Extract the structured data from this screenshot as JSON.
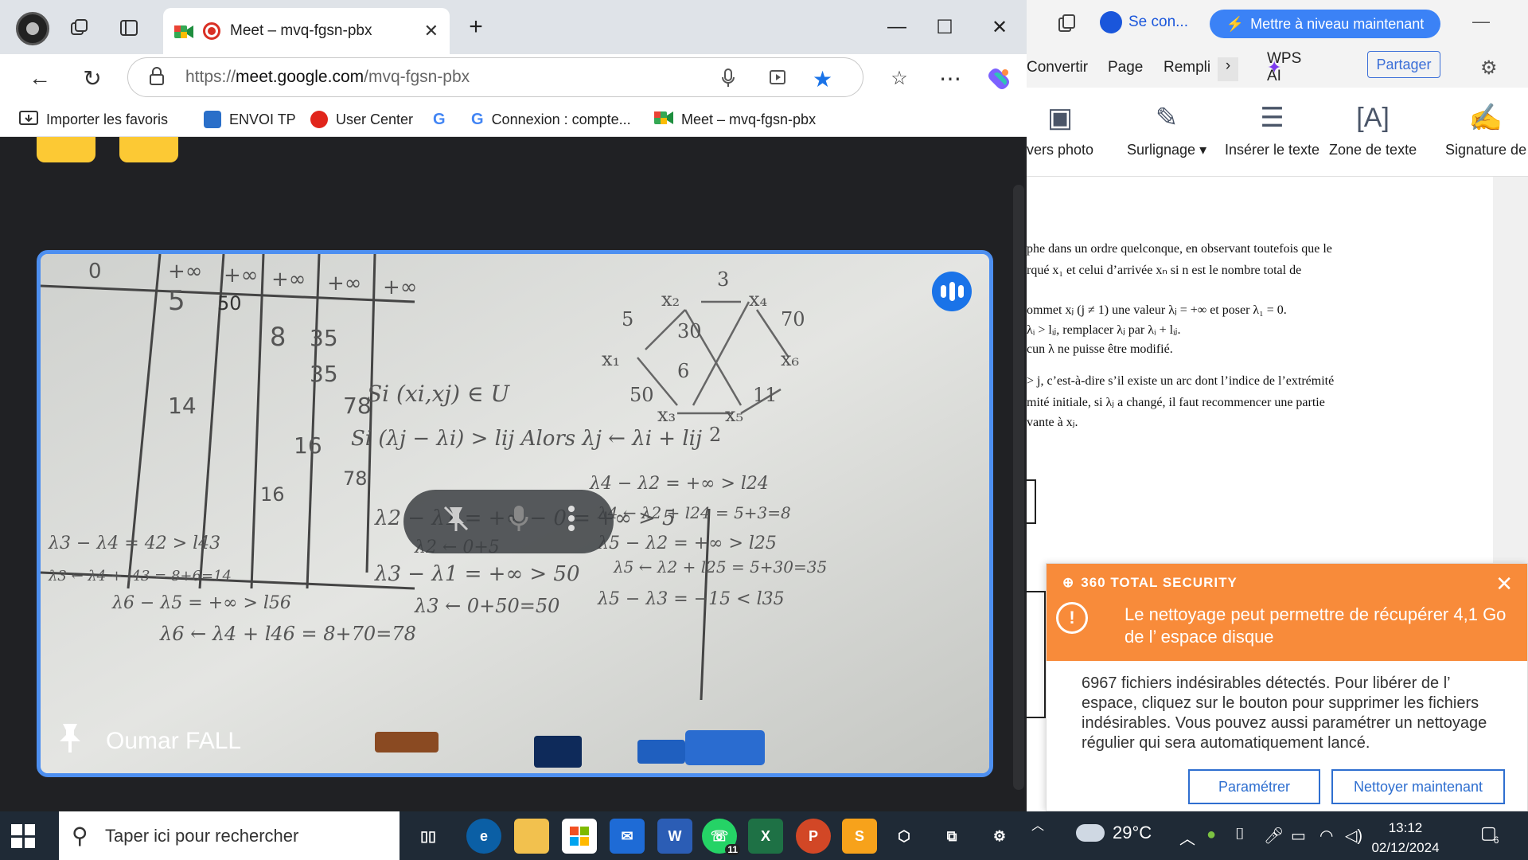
{
  "browser": {
    "tab": {
      "title": "Meet – mvq-fgsn-pbx"
    },
    "window_controls": {
      "minimize": "—",
      "maximize": "☐",
      "close": "✕"
    },
    "url": {
      "scheme": "https://",
      "host": "meet.google.com",
      "path": "/mvq-fgsn-pbx"
    },
    "bookmarks": [
      {
        "label": "Importer les favoris"
      },
      {
        "label": "ENVOI TP"
      },
      {
        "label": "User Center"
      },
      {
        "label": "Connexion : compte..."
      },
      {
        "label": "Meet – mvq-fgsn-pbx"
      }
    ]
  },
  "meet": {
    "participant_name": "Oumar FALL",
    "board_text": [
      "Si (xi,xj) ∈ U",
      "Si (λj − λi) > lij   Alors λj ← λi + lij",
      "λ2 − λ1 = +∞ − 0 = +∞ > 5",
      "λ2 ← 0+5",
      "λ3 − λ1 = +∞ > 50",
      "λ3 ← 0+50=50",
      "λ4 − λ2 = +∞ > l24",
      "λ4 ← λ2 + l24 = 5+3=8",
      "λ5 − λ2 = +∞ > l25",
      "λ5 ← λ2 + l25 = 5+30=35",
      "λ5 − λ3 = −15 < l35",
      "λ3 − λ4 = 42 > l43",
      "λ3 ← λ4 + l43 = 8+6=14",
      "λ6 − λ5 = +∞ > l56",
      "λ6 ← λ4 + l46 = 8+70=78"
    ],
    "table_cols": [
      "0",
      "+∞",
      "+∞",
      "+∞",
      "+∞",
      "+∞"
    ],
    "table_cells": [
      "5",
      "50",
      "8",
      "35",
      "35",
      "78",
      "14",
      "16",
      "16",
      "78"
    ]
  },
  "wps": {
    "signin": "Se con...",
    "upgrade": "Mettre à niveau maintenant",
    "menu": [
      "Convertir",
      "Page",
      "Rempli"
    ],
    "wps_ai": "WPS AI",
    "share": "Partager",
    "ribbon": [
      {
        "label": "vers photo"
      },
      {
        "label": "Surlignage"
      },
      {
        "label": "Insérer le texte"
      },
      {
        "label": "Zone de texte"
      },
      {
        "label": "Signature de"
      }
    ],
    "doc_lines": [
      "phe dans un ordre quelconque, en observant toutefois que le",
      "rqué x₁ et celui d’arrivée xₙ si n est le nombre total de",
      "",
      "ommet xⱼ (j ≠ 1) une valeur λⱼ = +∞ et poser λ₁ = 0.",
      "λᵢ > lᵢⱼ, remplacer λⱼ par λᵢ + lᵢⱼ.",
      "cun λ ne puisse être modifié.",
      "",
      "> j, c’est-à-dire s’il existe un arc dont l’indice de l’extrémité",
      "mité initiale, si λⱼ a changé, il faut recommencer une partie",
      "vante à xⱼ."
    ]
  },
  "popup": {
    "brand": "360 TOTAL SECURITY",
    "title": "Le nettoyage peut permettre de récupérer 4,1 Go de l’ espace disque",
    "body": "6967 fichiers indésirables détectés. Pour libérer de l’ espace, cliquez sur le bouton pour supprimer les fichiers indésirables. Vous pouvez aussi paramétrer un nettoyage régulier qui sera automatiquement lancé.",
    "btn_settings": "Paramétrer",
    "btn_clean": "Nettoyer maintenant",
    "accent": "#f88b3a"
  },
  "taskbar": {
    "search_placeholder": "Taper ici pour rechercher",
    "whatsapp_badge": "11",
    "temperature": "29°C",
    "time": "13:12",
    "date": "02/12/2024",
    "notifications": "6"
  }
}
